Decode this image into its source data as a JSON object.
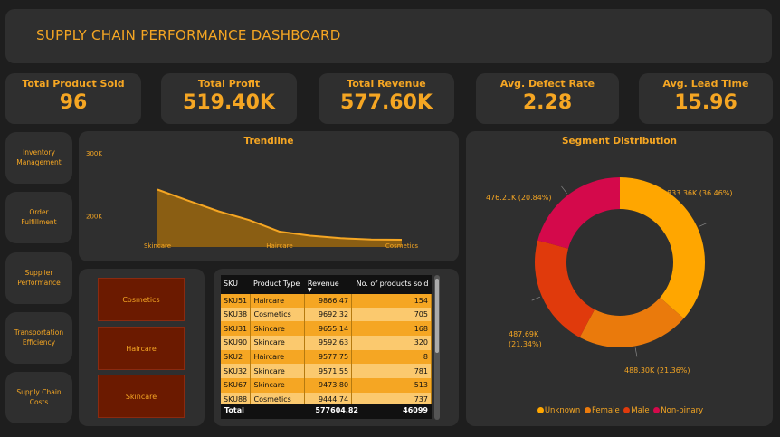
{
  "header": {
    "title": "SUPPLY CHAIN PERFORMANCE DASHBOARD"
  },
  "kpis": [
    {
      "label": "Total Product Sold",
      "value": "96"
    },
    {
      "label": "Total Profit",
      "value": "519.40K"
    },
    {
      "label": "Total Revenue",
      "value": "577.60K"
    },
    {
      "label": "Avg. Defect Rate",
      "value": "2.28"
    },
    {
      "label": "Avg. Lead Time",
      "value": "15.96"
    }
  ],
  "nav": [
    {
      "label": "Inventory Management"
    },
    {
      "label": "Order Fulfillment"
    },
    {
      "label": "Supplier Performance"
    },
    {
      "label": "Transportation Efficiency"
    },
    {
      "label": "Supply Chain Costs"
    }
  ],
  "slicer": {
    "items": [
      "Cosmetics",
      "Haircare",
      "Skincare"
    ]
  },
  "table": {
    "headers": [
      "SKU",
      "Product Type",
      "Revenue",
      "No. of products sold"
    ],
    "rows": [
      [
        "SKU51",
        "Haircare",
        "9866.47",
        "154"
      ],
      [
        "SKU38",
        "Cosmetics",
        "9692.32",
        "705"
      ],
      [
        "SKU31",
        "Skincare",
        "9655.14",
        "168"
      ],
      [
        "SKU90",
        "Skincare",
        "9592.63",
        "320"
      ],
      [
        "SKU2",
        "Haircare",
        "9577.75",
        "8"
      ],
      [
        "SKU32",
        "Skincare",
        "9571.55",
        "781"
      ],
      [
        "SKU67",
        "Skincare",
        "9473.80",
        "513"
      ],
      [
        "SKU88",
        "Cosmetics",
        "9444.74",
        "737"
      ]
    ],
    "total": {
      "label": "Total",
      "revenue": "577604.82",
      "sold": "46099"
    }
  },
  "colors": {
    "accent": "#f5a623",
    "panel": "#2f2f2f",
    "background": "#1e1e1e"
  },
  "chart_data": [
    {
      "type": "area",
      "title": "Trendline",
      "categories": [
        "Skincare",
        "Haircare",
        "Cosmetics"
      ],
      "x_points": [
        "Skincare",
        "",
        "",
        "",
        "Haircare",
        "",
        "",
        "",
        "Cosmetics"
      ],
      "values": [
        241628,
        224000,
        207000,
        193000,
        174455,
        168000,
        164000,
        162000,
        161521
      ],
      "y_ticks": [
        {
          "label": "300K",
          "value": 300000
        },
        {
          "label": "200K",
          "value": 200000
        }
      ],
      "ylim": [
        150000,
        300000
      ],
      "color": "#f5a623",
      "grid": false
    },
    {
      "type": "pie",
      "title": "Segment Distribution",
      "donut": true,
      "slices": [
        {
          "name": "Unknown",
          "value": 833.36,
          "percent": 36.46,
          "label": "833.36K (36.46%)",
          "color": "#ffa600"
        },
        {
          "name": "Female",
          "value": 488.3,
          "percent": 21.36,
          "label": "488.30K (21.36%)",
          "color": "#ea7a0c"
        },
        {
          "name": "Male",
          "value": 487.69,
          "percent": 21.34,
          "label": "487.69K (21.34%)",
          "color": "#e03a0c"
        },
        {
          "name": "Non-binary",
          "value": 476.21,
          "percent": 20.84,
          "label": "476.21K (20.84%)",
          "color": "#d4094b"
        }
      ],
      "legend": "bottom"
    }
  ]
}
